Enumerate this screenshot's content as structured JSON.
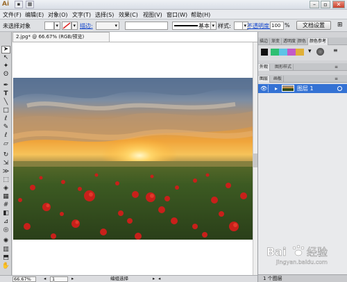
{
  "app": {
    "logo": "Ai"
  },
  "menu": [
    "文件(F)",
    "编辑(E)",
    "对象(O)",
    "文字(T)",
    "选择(S)",
    "效果(C)",
    "视图(V)",
    "窗口(W)",
    "帮助(H)"
  ],
  "control": {
    "no_selection": "未选择对象",
    "stroke_label": "描边:",
    "stroke_style": "基本",
    "style_label": "样式:",
    "opacity_label": "不透明度:",
    "opacity_value": "100",
    "opacity_unit": "%",
    "doc_setup": "文档设置"
  },
  "document": {
    "tab_title": "2.jpg* @ 66.67% (RGB/预览)"
  },
  "status": {
    "zoom": "66.67%",
    "page": "1",
    "mode": "编组选择"
  },
  "panels": {
    "top_tabs": [
      "描边",
      "渐变",
      "透明度",
      "颜色",
      "颜色参考"
    ],
    "mid_tabs": [
      "外观",
      "图形样式"
    ],
    "layer_tabs": [
      "图层",
      "画板"
    ],
    "layer_name": "图层 1",
    "layer_count": "1 个图层"
  },
  "watermark": {
    "brand": "Bai",
    "brand_cn": "经验",
    "url": "jingyan.baidu.com"
  },
  "colors": {
    "selection": "#3472d4",
    "swatches": [
      "#2fbf72",
      "#5dc4e6",
      "#c35ac8",
      "#e0b038"
    ]
  }
}
